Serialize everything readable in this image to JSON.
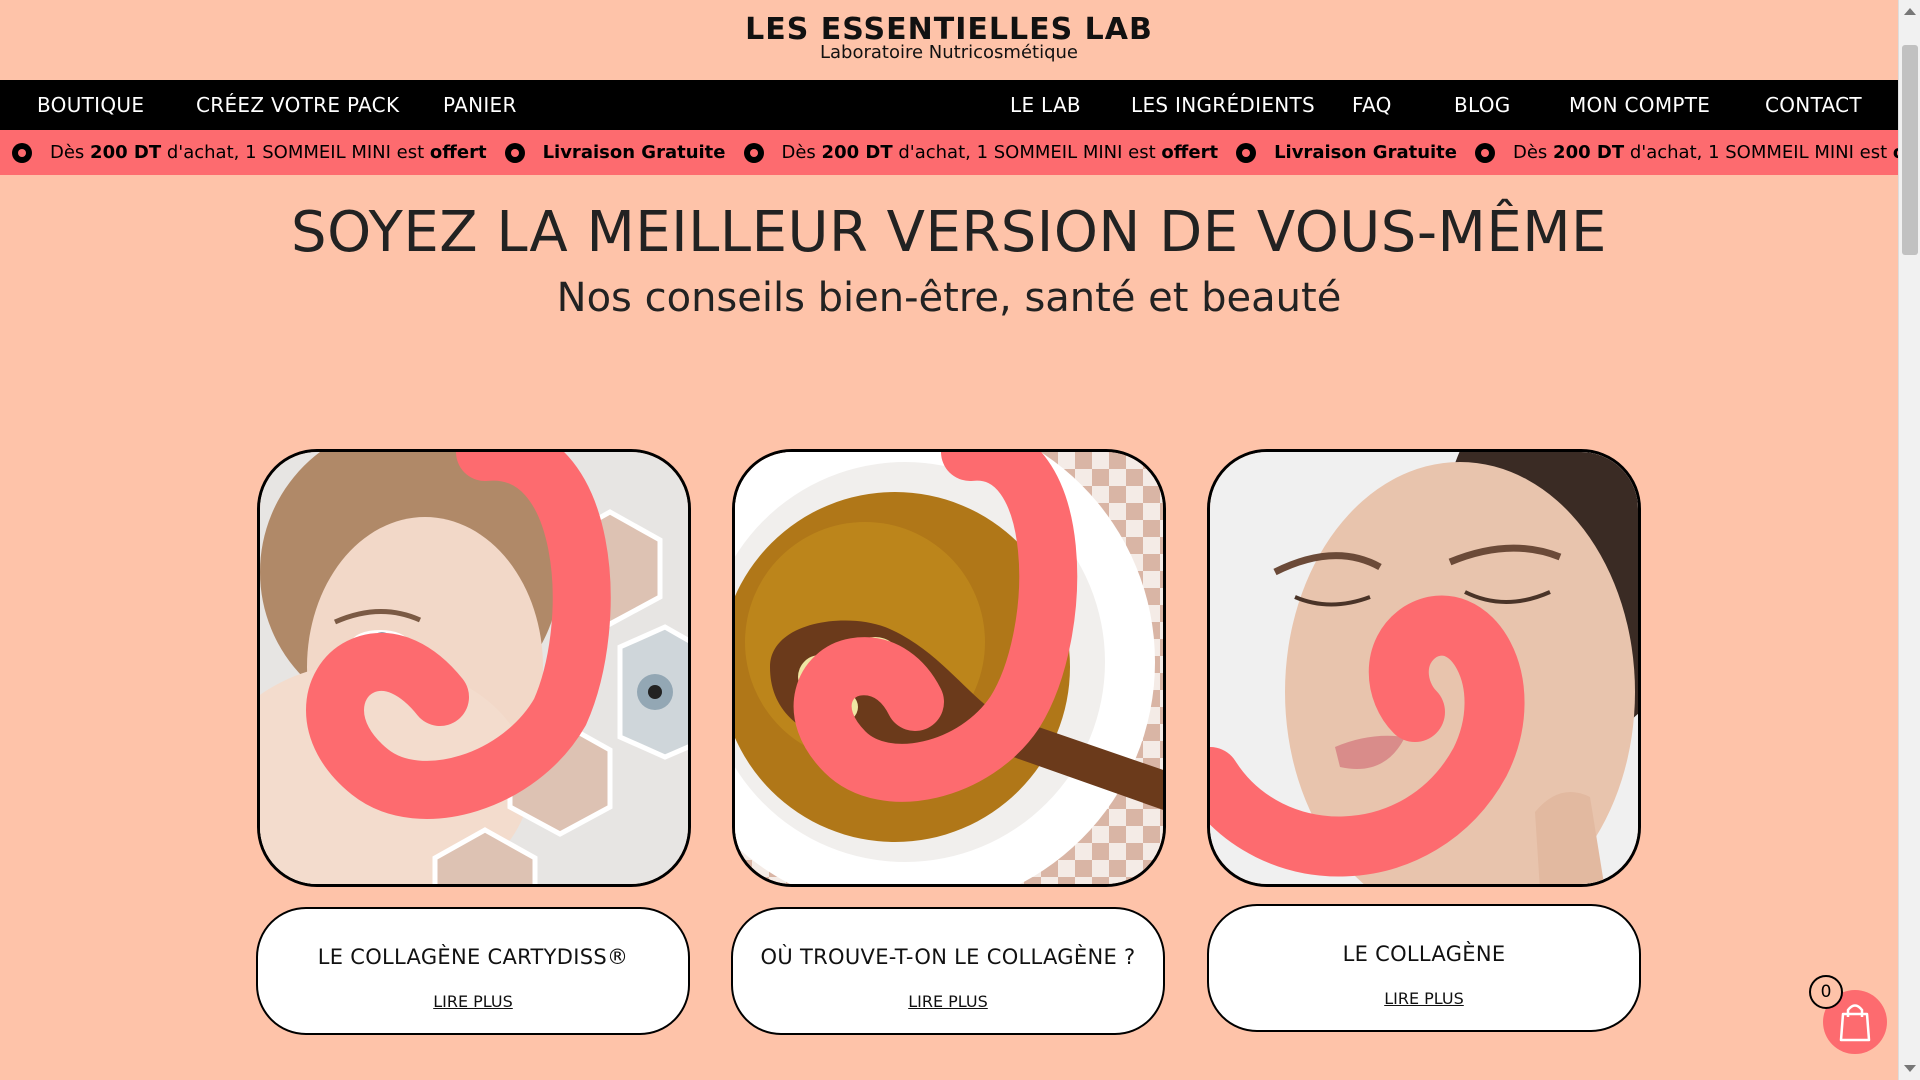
{
  "header": {
    "logo_title": "LES ESSENTIELLES LAB",
    "logo_subtitle": "Laboratoire Nutricosmétique"
  },
  "nav": {
    "left": [
      "BOUTIQUE",
      "CRÉEZ VOTRE PACK",
      "PANIER"
    ],
    "right": [
      "LE LAB",
      "LES INGRÉDIENTS",
      "FAQ",
      "BLOG",
      "MON COMPTE",
      "CONTACT"
    ]
  },
  "ticker": {
    "promo_prefix": "Dès",
    "promo_amount": "200 DT",
    "promo_middle": "d'achat, 1 SOMMEIL MINI est",
    "promo_offer": "offert",
    "shipping": "Livraison Gratuite"
  },
  "hero": {
    "title": "SOYEZ LA MEILLEUR VERSION DE VOUS-MÊME",
    "subtitle": "Nos conseils bien-être, santé et beauté"
  },
  "cards": [
    {
      "title": "LE COLLAGÈNE CARTYDISS®",
      "link": "LIRE PLUS",
      "image": "woman-face-skin-hexagons"
    },
    {
      "title": "OÙ TROUVE-T-ON LE COLLAGÈNE ?",
      "link": "LIRE PLUS",
      "image": "soup-bowl-wooden-spoon"
    },
    {
      "title": "LE COLLAGÈNE",
      "link": "LIRE PLUS",
      "image": "woman-eyes-closed-face"
    }
  ],
  "cart": {
    "count": "0",
    "icon": "shopping-bag-icon"
  },
  "colors": {
    "background": "#fec3a9",
    "accent": "#fd6b6f",
    "nav_bg": "#000000"
  }
}
